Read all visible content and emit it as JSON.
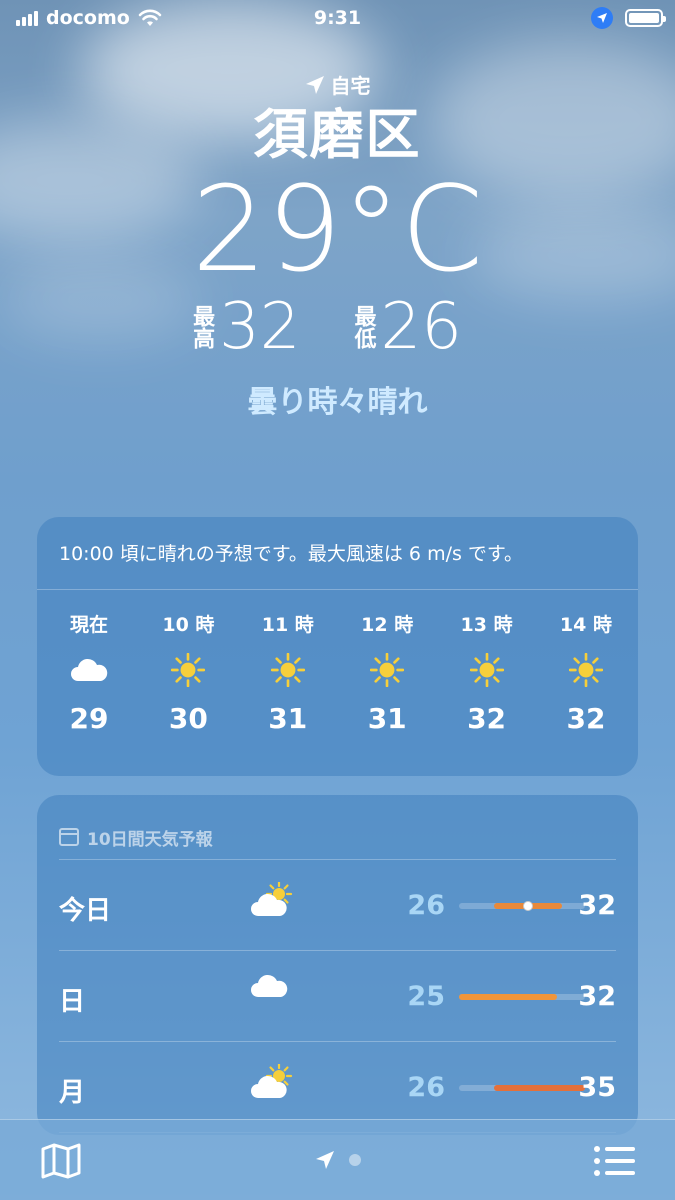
{
  "status_bar": {
    "carrier": "docomo",
    "time": "9:31"
  },
  "location": {
    "home_label": "自宅",
    "city": "須磨区",
    "temperature": "29°C",
    "high_label": "最高",
    "high": "32",
    "low_label": "最低",
    "low": "26",
    "condition": "曇り時々晴れ"
  },
  "hourly": {
    "summary": "10:00 頃に晴れの予想です。最大風速は 6 m/s です。",
    "hours": [
      {
        "label": "現在",
        "icon": "cloud-icon",
        "temp": "29"
      },
      {
        "label": "10 時",
        "icon": "sun-icon",
        "temp": "30"
      },
      {
        "label": "11 時",
        "icon": "sun-icon",
        "temp": "31"
      },
      {
        "label": "12 時",
        "icon": "sun-icon",
        "temp": "31"
      },
      {
        "label": "13 時",
        "icon": "sun-icon",
        "temp": "32"
      },
      {
        "label": "14 時",
        "icon": "sun-icon",
        "temp": "32"
      }
    ]
  },
  "daily": {
    "title": "10日間天気予報",
    "rows": [
      {
        "day": "今日",
        "icon": "partly-cloudy-icon",
        "low": "26",
        "high": "32",
        "range_start": 0.28,
        "range_end": 0.82,
        "current_marker": 0.55,
        "bar_color": "#e8893a"
      },
      {
        "day": "日",
        "icon": "cloud-icon",
        "low": "25",
        "high": "32",
        "range_start": 0.0,
        "range_end": 0.78,
        "bar_color": "#f0953a"
      },
      {
        "day": "月",
        "icon": "partly-cloudy-icon",
        "low": "26",
        "high": "35",
        "range_start": 0.28,
        "range_end": 1.0,
        "bar_color": "#e4703a"
      }
    ]
  },
  "tab_bar": {
    "left_icon": "map-icon",
    "center_icon": "location-arrow-icon",
    "right_icon": "list-icon"
  }
}
